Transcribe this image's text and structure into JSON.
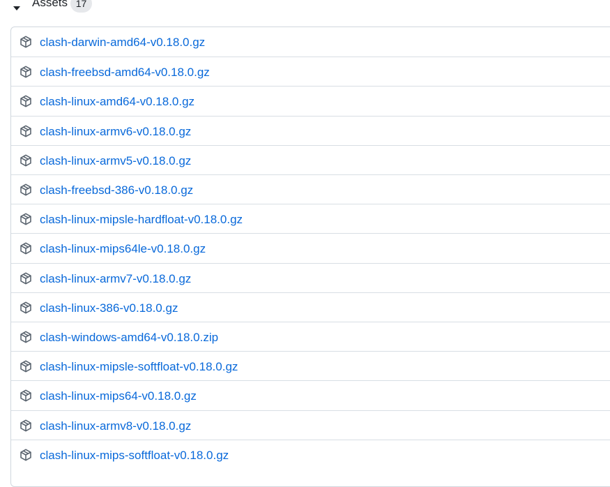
{
  "assets": {
    "title": "Assets",
    "count": "17",
    "items": [
      {
        "name": "clash-darwin-amd64-v0.18.0.gz",
        "icon": "package-icon"
      },
      {
        "name": "clash-freebsd-amd64-v0.18.0.gz",
        "icon": "package-icon"
      },
      {
        "name": "clash-linux-amd64-v0.18.0.gz",
        "icon": "package-icon"
      },
      {
        "name": "clash-linux-armv6-v0.18.0.gz",
        "icon": "package-icon"
      },
      {
        "name": "clash-linux-armv5-v0.18.0.gz",
        "icon": "package-icon"
      },
      {
        "name": "clash-freebsd-386-v0.18.0.gz",
        "icon": "package-icon"
      },
      {
        "name": "clash-linux-mipsle-hardfloat-v0.18.0.gz",
        "icon": "package-icon"
      },
      {
        "name": "clash-linux-mips64le-v0.18.0.gz",
        "icon": "package-icon"
      },
      {
        "name": "clash-linux-armv7-v0.18.0.gz",
        "icon": "package-icon"
      },
      {
        "name": "clash-linux-386-v0.18.0.gz",
        "icon": "package-icon"
      },
      {
        "name": "clash-windows-amd64-v0.18.0.zip",
        "icon": "package-icon"
      },
      {
        "name": "clash-linux-mipsle-softfloat-v0.18.0.gz",
        "icon": "package-icon"
      },
      {
        "name": "clash-linux-mips64-v0.18.0.gz",
        "icon": "package-icon"
      },
      {
        "name": "clash-linux-armv8-v0.18.0.gz",
        "icon": "package-icon"
      },
      {
        "name": "clash-linux-mips-softfloat-v0.18.0.gz",
        "icon": "package-icon"
      }
    ]
  },
  "colors": {
    "link": "#0969da",
    "text": "#1f2328",
    "border": "#d0d7de",
    "badge_bg": "#e6e8eb",
    "icon": "#59636e"
  }
}
